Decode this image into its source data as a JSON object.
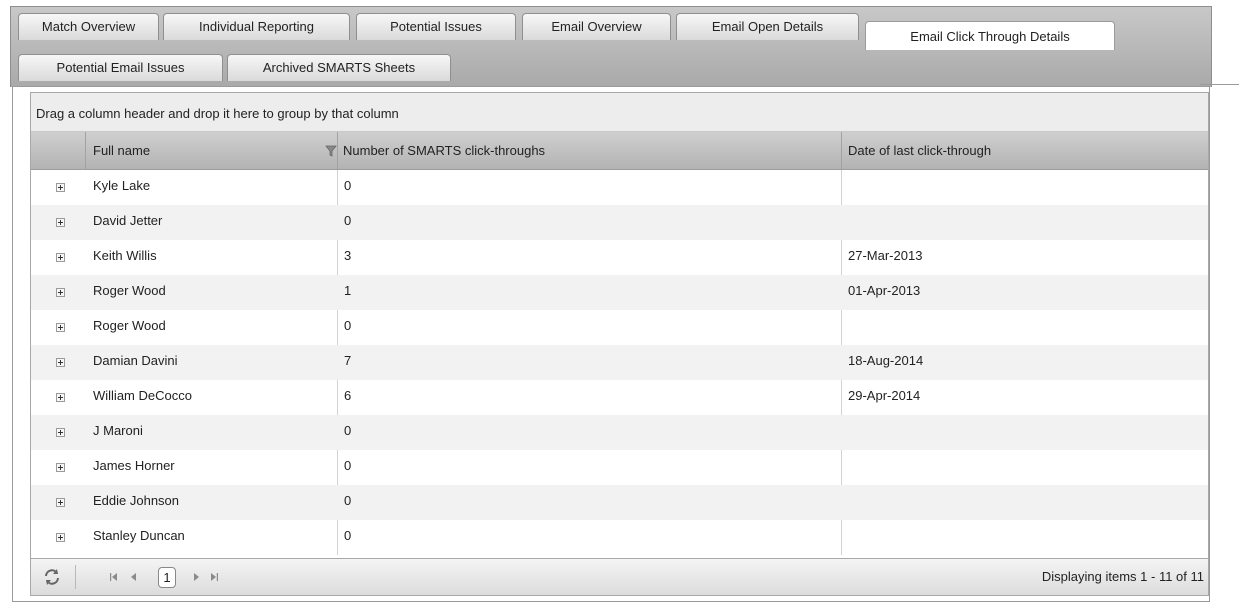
{
  "tabs": [
    {
      "label": "Match Overview",
      "active": false
    },
    {
      "label": "Individual Reporting",
      "active": false
    },
    {
      "label": "Potential Issues",
      "active": false
    },
    {
      "label": "Email Overview",
      "active": false
    },
    {
      "label": "Email Open Details",
      "active": false
    },
    {
      "label": "Email Click Through Details",
      "active": true
    },
    {
      "label": "Potential Email Issues",
      "active": false
    },
    {
      "label": "Archived SMARTS Sheets",
      "active": false
    }
  ],
  "grid": {
    "group_hint": "Drag a column header and drop it here to group by that column",
    "columns": [
      "Full name",
      "Number of SMARTS click-throughs",
      "Date of last click-through"
    ],
    "rows": [
      {
        "name": "Kyle Lake",
        "clicks": "0",
        "date": ""
      },
      {
        "name": "David Jetter",
        "clicks": "0",
        "date": ""
      },
      {
        "name": "Keith Willis",
        "clicks": "3",
        "date": "27-Mar-2013"
      },
      {
        "name": "Roger Wood",
        "clicks": "1",
        "date": "01-Apr-2013"
      },
      {
        "name": "Roger Wood",
        "clicks": "0",
        "date": ""
      },
      {
        "name": "Damian Davini",
        "clicks": "7",
        "date": "18-Aug-2014"
      },
      {
        "name": "William DeCocco",
        "clicks": "6",
        "date": "29-Apr-2014"
      },
      {
        "name": "J Maroni",
        "clicks": "0",
        "date": ""
      },
      {
        "name": "James Horner",
        "clicks": "0",
        "date": ""
      },
      {
        "name": "Eddie Johnson",
        "clicks": "0",
        "date": ""
      },
      {
        "name": "Stanley Duncan",
        "clicks": "0",
        "date": ""
      }
    ]
  },
  "pager": {
    "current_page": "1",
    "info": "Displaying items 1 - 11 of 11"
  },
  "icons": {
    "refresh": "refresh-icon",
    "first": "first-page-icon",
    "prev": "previous-page-icon",
    "next": "next-page-icon",
    "last": "last-page-icon",
    "filter": "filter-icon",
    "expand": "expand-row-icon"
  }
}
